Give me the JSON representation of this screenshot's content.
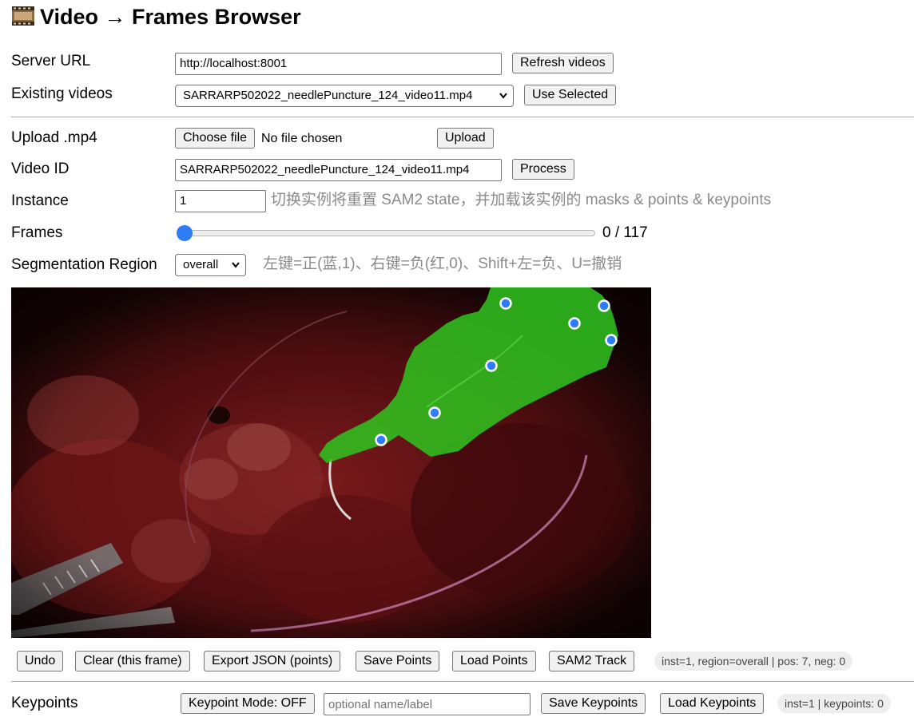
{
  "title": "Video → Frames Browser",
  "title_icon": "film-frames-icon",
  "server": {
    "label": "Server URL",
    "value": "http://localhost:8001",
    "refresh_label": "Refresh videos"
  },
  "existing": {
    "label": "Existing videos",
    "selected": "SARRARP502022_needlePuncture_124_video11.mp4",
    "use_label": "Use Selected"
  },
  "upload": {
    "label": "Upload .mp4",
    "choose_label": "Choose file",
    "status": "No file chosen",
    "upload_label": "Upload"
  },
  "video_id": {
    "label": "Video ID",
    "value": "SARRARP502022_needlePuncture_124_video11.mp4",
    "process_label": "Process"
  },
  "instance": {
    "label": "Instance",
    "value": "1",
    "hint": "切换实例将重置 SAM2 state，并加载该实例的 masks & points & keypoints"
  },
  "frames": {
    "label": "Frames",
    "current": 0,
    "total": 117,
    "readout": "0 / 117"
  },
  "segmentation": {
    "label": "Segmentation Region",
    "selected": "overall",
    "hint": "左键=正(蓝,1)、右键=负(红,0)、Shift+左=负、U=撤销"
  },
  "overlay": {
    "mask_color": "#2fc41e",
    "positive_point_color": "#2d7bff",
    "negative_point_color": "#e03030"
  },
  "toolbar": {
    "undo": "Undo",
    "clear": "Clear (this frame)",
    "export": "Export JSON (points)",
    "save_points": "Save Points",
    "load_points": "Load Points",
    "track": "SAM2 Track",
    "status": "inst=1, region=overall | pos: 7, neg: 0"
  },
  "keypoints": {
    "label": "Keypoints",
    "mode_label": "Keypoint Mode: OFF",
    "name_placeholder": "optional name/label",
    "save_label": "Save Keypoints",
    "load_label": "Load Keypoints",
    "status": "inst=1 | keypoints: 0"
  }
}
